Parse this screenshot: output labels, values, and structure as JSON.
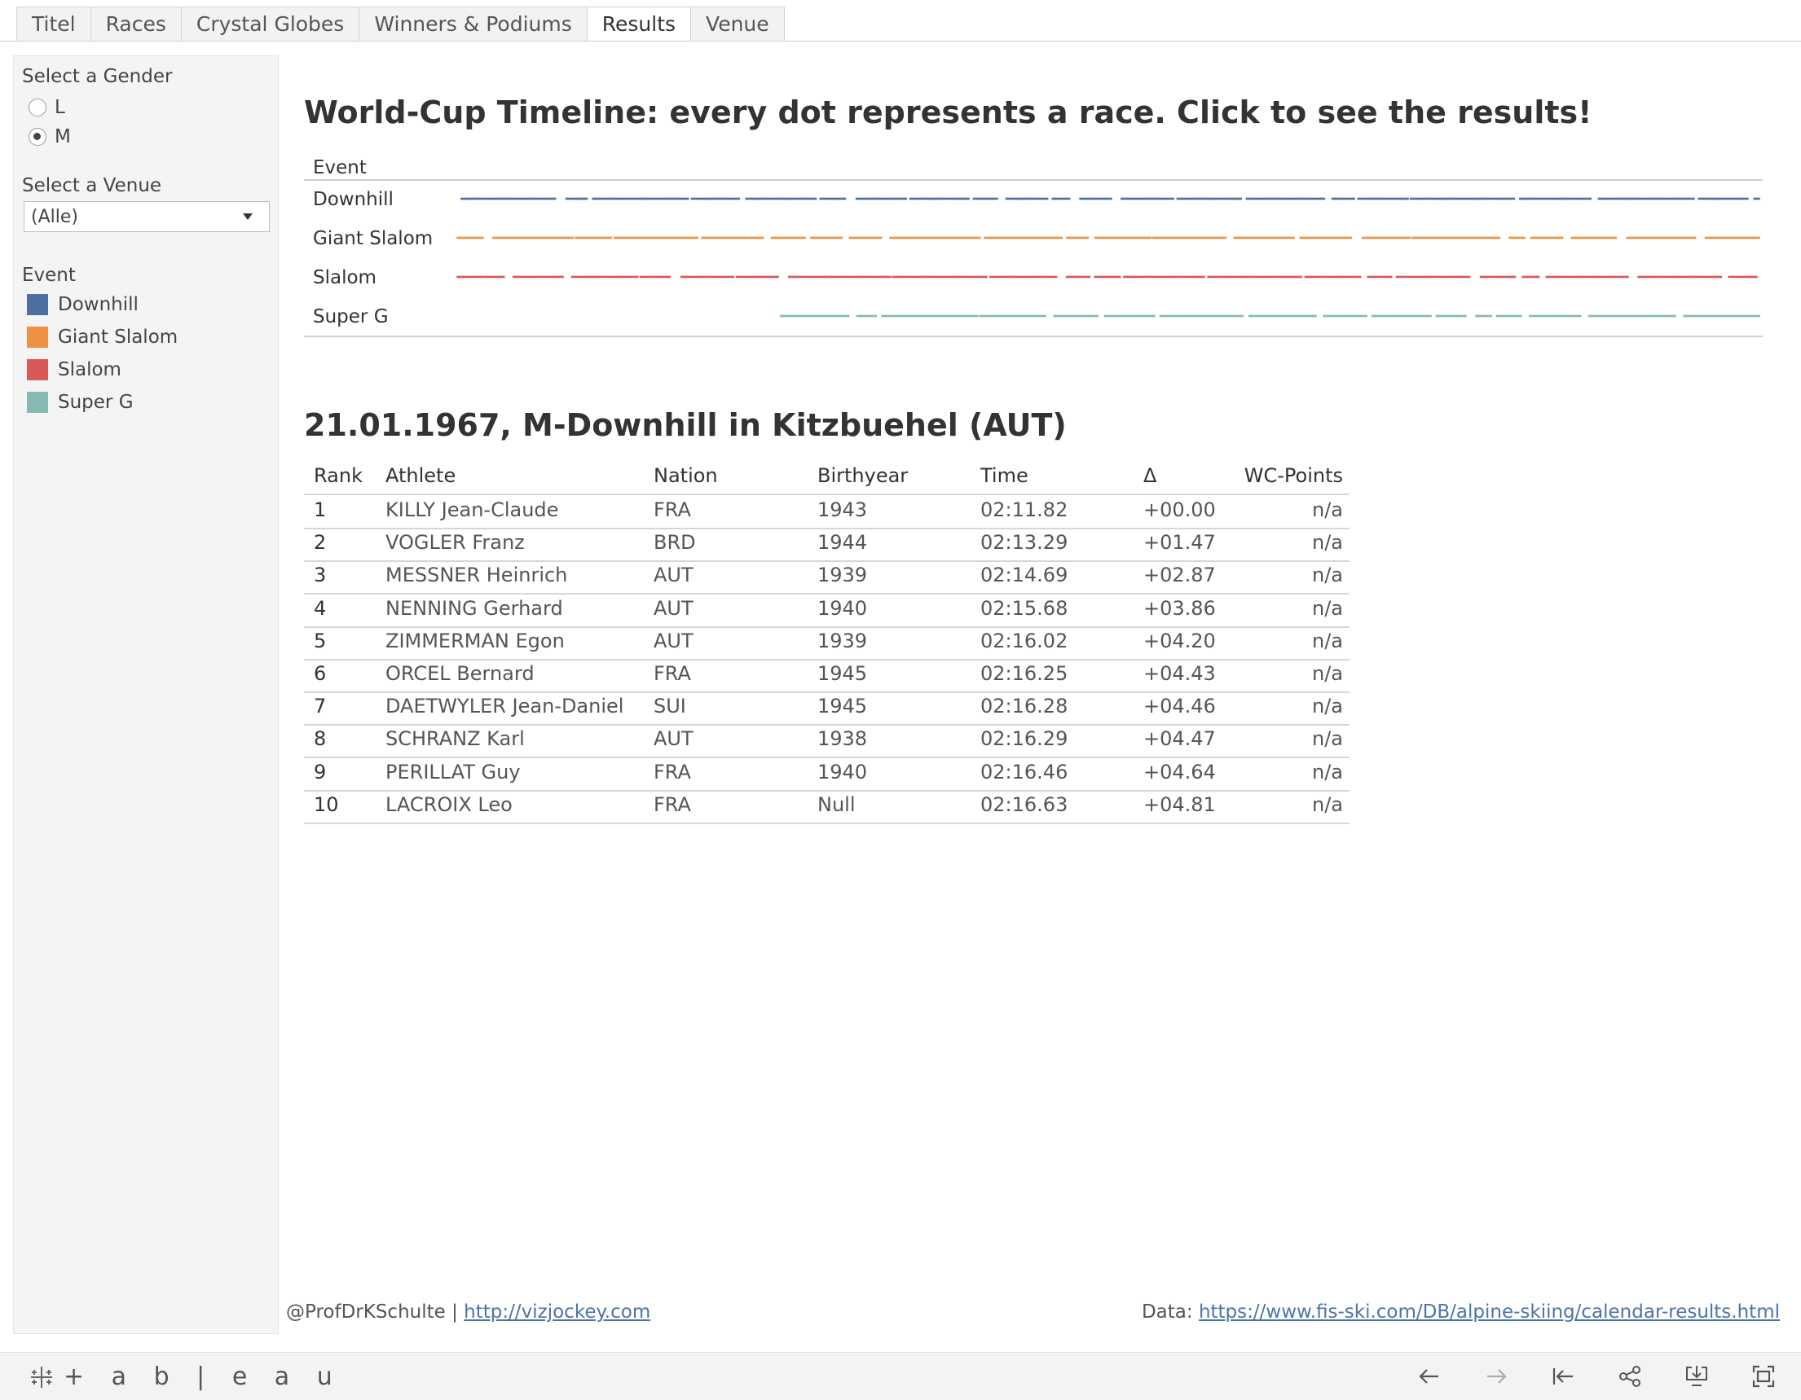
{
  "tabs": [
    {
      "label": "Titel",
      "active": false
    },
    {
      "label": "Races",
      "active": false
    },
    {
      "label": "Crystal Globes",
      "active": false
    },
    {
      "label": "Winners & Podiums",
      "active": false
    },
    {
      "label": "Results",
      "active": true
    },
    {
      "label": "Venue",
      "active": false
    }
  ],
  "sidebar": {
    "gender_label": "Select a Gender",
    "gender_options": [
      {
        "label": "L",
        "selected": false
      },
      {
        "label": "M",
        "selected": true
      }
    ],
    "venue_label": "Select a Venue",
    "venue_value": "(Alle)",
    "legend_title": "Event",
    "legend": [
      {
        "label": "Downhill",
        "color": "#4e6f9f"
      },
      {
        "label": "Giant Slalom",
        "color": "#ee9141"
      },
      {
        "label": "Slalom",
        "color": "#d9585a"
      },
      {
        "label": "Super G",
        "color": "#86b9b4"
      }
    ]
  },
  "timeline": {
    "title": "World-Cup Timeline: every dot represents a race. Click to see the results!",
    "header": "Event",
    "rows": [
      {
        "label": "Downhill",
        "color": "#4e6f9f",
        "start": 0.003,
        "end": 1.0
      },
      {
        "label": "Giant Slalom",
        "color": "#ee9141",
        "start": 0.0,
        "end": 1.0
      },
      {
        "label": "Slalom",
        "color": "#d9585a",
        "start": 0.0,
        "end": 0.998
      },
      {
        "label": "Super G",
        "color": "#86b9b4",
        "start": 0.248,
        "end": 1.0
      }
    ]
  },
  "race": {
    "title": "21.01.1967, M-Downhill in Kitzbuehel (AUT)",
    "columns": [
      "Rank",
      "Athlete",
      "Nation",
      "Birthyear",
      "Time",
      "Δ",
      "WC-Points"
    ],
    "rows": [
      [
        "1",
        "KILLY Jean-Claude",
        "FRA",
        "1943",
        "02:11.82",
        "+00.00",
        "n/a"
      ],
      [
        "2",
        "VOGLER Franz",
        "BRD",
        "1944",
        "02:13.29",
        "+01.47",
        "n/a"
      ],
      [
        "3",
        "MESSNER Heinrich",
        "AUT",
        "1939",
        "02:14.69",
        "+02.87",
        "n/a"
      ],
      [
        "4",
        "NENNING Gerhard",
        "AUT",
        "1940",
        "02:15.68",
        "+03.86",
        "n/a"
      ],
      [
        "5",
        "ZIMMERMAN Egon",
        "AUT",
        "1939",
        "02:16.02",
        "+04.20",
        "n/a"
      ],
      [
        "6",
        "ORCEL Bernard",
        "FRA",
        "1945",
        "02:16.25",
        "+04.43",
        "n/a"
      ],
      [
        "7",
        "DAETWYLER Jean-Daniel",
        "SUI",
        "1945",
        "02:16.28",
        "+04.46",
        "n/a"
      ],
      [
        "8",
        "SCHRANZ Karl",
        "AUT",
        "1938",
        "02:16.29",
        "+04.47",
        "n/a"
      ],
      [
        "9",
        "PERILLAT Guy",
        "FRA",
        "1940",
        "02:16.46",
        "+04.64",
        "n/a"
      ],
      [
        "10",
        "LACROIX Leo",
        "FRA",
        "Null",
        "02:16.63",
        "+04.81",
        "n/a"
      ]
    ]
  },
  "footer": {
    "author": "@ProfDrKSchulte | ",
    "author_link": "http://vizjockey.com",
    "data_label": "Data: ",
    "data_link": "https://www.fis-ski.com/DB/alpine-skiing/calendar-results.html"
  },
  "toolbar": {
    "brand": "+ a b | e a u",
    "icons": [
      "back-arrow-icon",
      "forward-arrow-icon",
      "revert-icon",
      "share-icon",
      "download-icon",
      "fullscreen-icon"
    ]
  }
}
